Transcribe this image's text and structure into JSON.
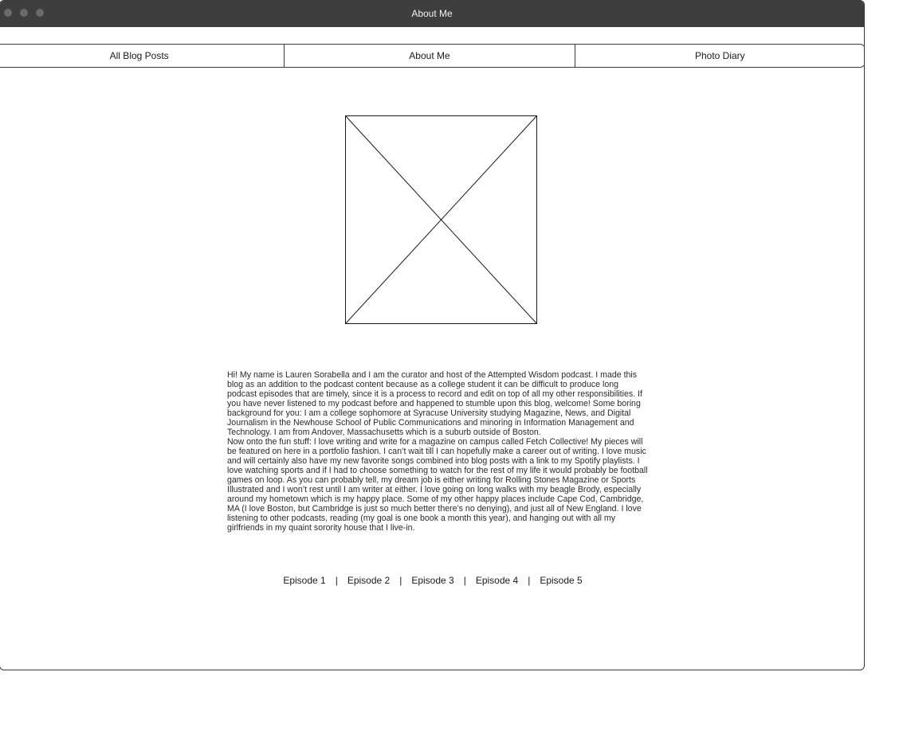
{
  "window": {
    "title": "About Me"
  },
  "nav": {
    "tabs": [
      {
        "label": "All Blog Posts"
      },
      {
        "label": "About Me"
      },
      {
        "label": "Photo Diary"
      }
    ]
  },
  "image": {
    "placeholder_icon": "image-placeholder-icon"
  },
  "bio": {
    "paragraphs": [
      "Hi! My name is Lauren Sorabella and I am the curator and host of the Attempted Wisdom podcast. I made this blog as an addition to the podcast content because as a college student it can be difficult to produce long podcast episodes that are timely, since it is a process to record and edit on top of all my other responsibilities. If you have never listened to my podcast before and happened to stumble upon this blog, welcome! Some boring background for you: I am a college sophomore at Syracuse University studying Magazine, News, and Digital Journalism in the Newhouse School of Public Communications and minoring in Information Management and Technology. I am from Andover, Massachusetts which is a suburb outside of Boston.",
      "Now onto the fun stuff: I love writing and write for a magazine on campus called Fetch Collective! My pieces will be featured on here in a portfolio fashion. I can’t wait till I can hopefully make a career out of writing. I love music and will certainly also have my new favorite songs combined into blog posts with a link to my Spotify playlists. I love watching sports and if I had to choose something to watch for the rest of my life it would probably be football games on loop. As you can probably tell, my dream job is either writing for Rolling Stones Magazine or Sports Illustrated and I won’t rest until I am writer at either. I love going on long walks with my beagle Brody, especially around my hometown which is my happy place. Some of my other happy places include Cape Cod, Cambridge, MA (I love Boston, but Cambridge is just so much better there’s no denying), and just all of New England. I love listening to other podcasts, reading (my goal is one book a month this year), and hanging out with all my girlfriends in my quaint sorority house that I live-in."
    ]
  },
  "episodes": {
    "separator": "|",
    "items": [
      {
        "label": "Episode 1"
      },
      {
        "label": "Episode 2"
      },
      {
        "label": "Episode 3"
      },
      {
        "label": "Episode 4"
      },
      {
        "label": "Episode 5"
      }
    ]
  }
}
